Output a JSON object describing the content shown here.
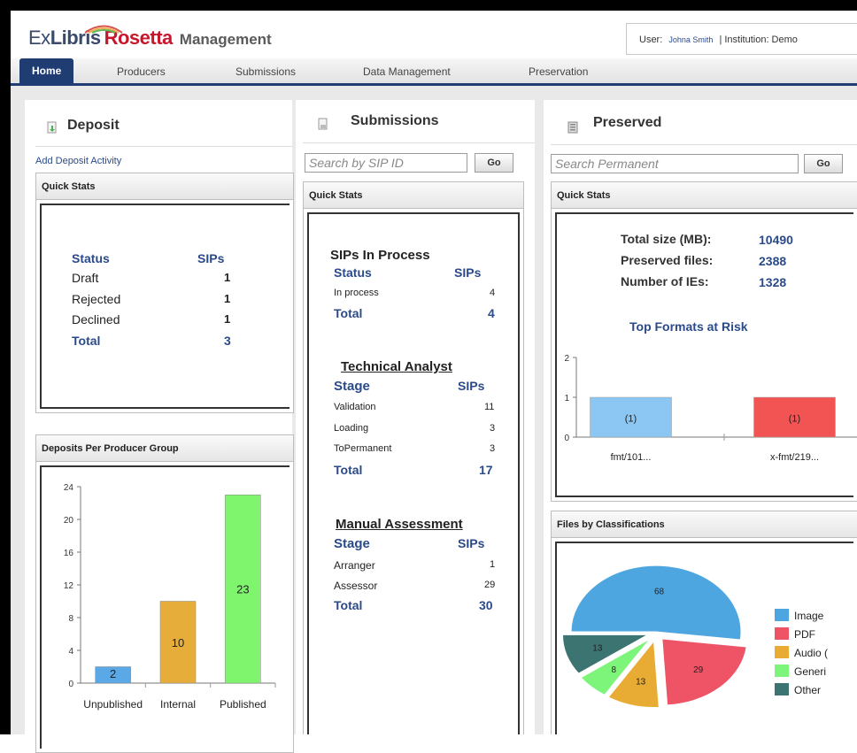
{
  "header": {
    "logo": {
      "ex": "Ex",
      "libris": "Libris",
      "rosetta": "Rosetta",
      "management": "Management"
    },
    "user_label": "User:",
    "user_name": "Johna Smith",
    "separator": "|",
    "institution_label": "Institution: Demo"
  },
  "nav": {
    "tabs": [
      {
        "label": "Home",
        "active": true
      },
      {
        "label": "Producers"
      },
      {
        "label": "Submissions"
      },
      {
        "label": "Data Management"
      },
      {
        "label": "Preservation"
      }
    ]
  },
  "deposit": {
    "title": "Deposit",
    "add_link": "Add Deposit Activity",
    "quick_stats": {
      "title": "Quick Stats",
      "col_status": "Status",
      "col_sips": "SIPs",
      "rows": [
        {
          "status": "Draft",
          "sips": "1"
        },
        {
          "status": "Rejected",
          "sips": "1"
        },
        {
          "status": "Declined",
          "sips": "1"
        }
      ],
      "total_label": "Total",
      "total_value": "3"
    },
    "producer_group": {
      "title": "Deposits Per Producer Group"
    }
  },
  "submissions": {
    "title": "Submissions",
    "search_placeholder": "Search by SIP ID",
    "go_label": "Go",
    "quick_stats": {
      "title": "Quick Stats",
      "in_process": {
        "heading": "SIPs In Process",
        "col_status": "Status",
        "col_sips": "SIPs",
        "rows": [
          {
            "label": "In process",
            "value": "4"
          }
        ],
        "total_label": "Total",
        "total_value": "4"
      },
      "technical": {
        "heading": "Technical Analyst",
        "col_stage": "Stage",
        "col_sips": "SIPs",
        "rows": [
          {
            "label": "Validation",
            "value": "11"
          },
          {
            "label": "Loading",
            "value": "3"
          },
          {
            "label": "ToPermanent",
            "value": "3"
          }
        ],
        "total_label": "Total",
        "total_value": "17"
      },
      "manual": {
        "heading": "Manual Assessment",
        "col_stage": "Stage",
        "col_sips": "SIPs",
        "rows": [
          {
            "label": "Arranger",
            "value": "1"
          },
          {
            "label": "Assessor",
            "value": "29"
          }
        ],
        "total_label": "Total",
        "total_value": "30"
      }
    }
  },
  "preserved": {
    "title": "Preserved",
    "search_placeholder": "Search Permanent",
    "go_label": "Go",
    "quick_stats": {
      "title": "Quick Stats",
      "total_size_label": "Total size (MB):",
      "total_size_value": "10490",
      "preserved_files_label": "Preserved files:",
      "preserved_files_value": "2388",
      "ies_label": "Number of IEs:",
      "ies_value": "1328",
      "formats_heading": "Top Formats at Risk"
    },
    "classifications": {
      "title": "Files by Classifications"
    }
  },
  "chart_data": [
    {
      "type": "bar",
      "categories": [
        "Unpublished",
        "Internal",
        "Published"
      ],
      "values": [
        2,
        10,
        23
      ],
      "value_labels": [
        "2",
        "10",
        "23"
      ],
      "ylim": [
        0,
        24
      ],
      "yticks": [
        "0",
        "4",
        "8",
        "12",
        "16",
        "20",
        "24"
      ],
      "colors": [
        "#5aa9e6",
        "#e6ad3a",
        "#7ff56e"
      ]
    },
    {
      "type": "bar",
      "categories": [
        "fmt/101...",
        "x-fmt/219..."
      ],
      "values": [
        1,
        1
      ],
      "value_labels": [
        "(1)",
        "(1)"
      ],
      "ylim": [
        0,
        2
      ],
      "yticks": [
        "0",
        "1",
        "2"
      ],
      "colors": [
        "#8cc6f2",
        "#f25454"
      ]
    },
    {
      "type": "pie",
      "labels": [
        "Image",
        "PDF",
        "Audio (",
        "Generi",
        "Other"
      ],
      "values": [
        68,
        29,
        13,
        8,
        13
      ],
      "value_labels": [
        "68",
        "29",
        "13",
        "8",
        "13"
      ],
      "colors": [
        "#4da6df",
        "#ee5366",
        "#e8ac35",
        "#7df57a",
        "#3b7470"
      ]
    }
  ]
}
